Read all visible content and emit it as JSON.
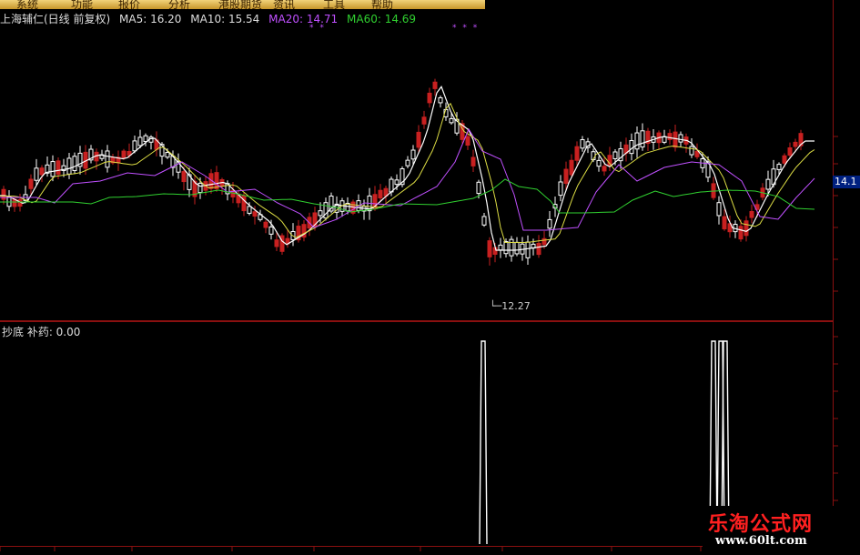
{
  "menu": {
    "items": [
      "系统",
      "功能",
      "报价",
      "分析",
      "港股期货",
      "资讯",
      "工具",
      "帮助"
    ]
  },
  "header": {
    "stock": "上海辅仁(日线 前复权)",
    "ma5": "MA5: 16.20",
    "ma10": "MA10: 15.54",
    "ma20": "MA20: 14.71",
    "ma60": "MA60: 14.69",
    "stars_a": "* *",
    "stars_b": "* * *"
  },
  "colors": {
    "ma5": "#ffffff",
    "ma10": "#dddd44",
    "ma20": "#c050ff",
    "ma60": "#30d030",
    "up": "#c82020",
    "down": "#ffffff",
    "axis": "#8a1010"
  },
  "price_panel": {
    "current_price": "14.1",
    "low_marker": "12.27"
  },
  "indicator_panel": {
    "label": "抄底 补药: 0.00"
  },
  "watermark": {
    "title": "乐淘公式网",
    "url": "www.60lt.com"
  },
  "chart_data": {
    "type": "line",
    "low_annotation": 12.27,
    "indicator_value": 0.0
  }
}
